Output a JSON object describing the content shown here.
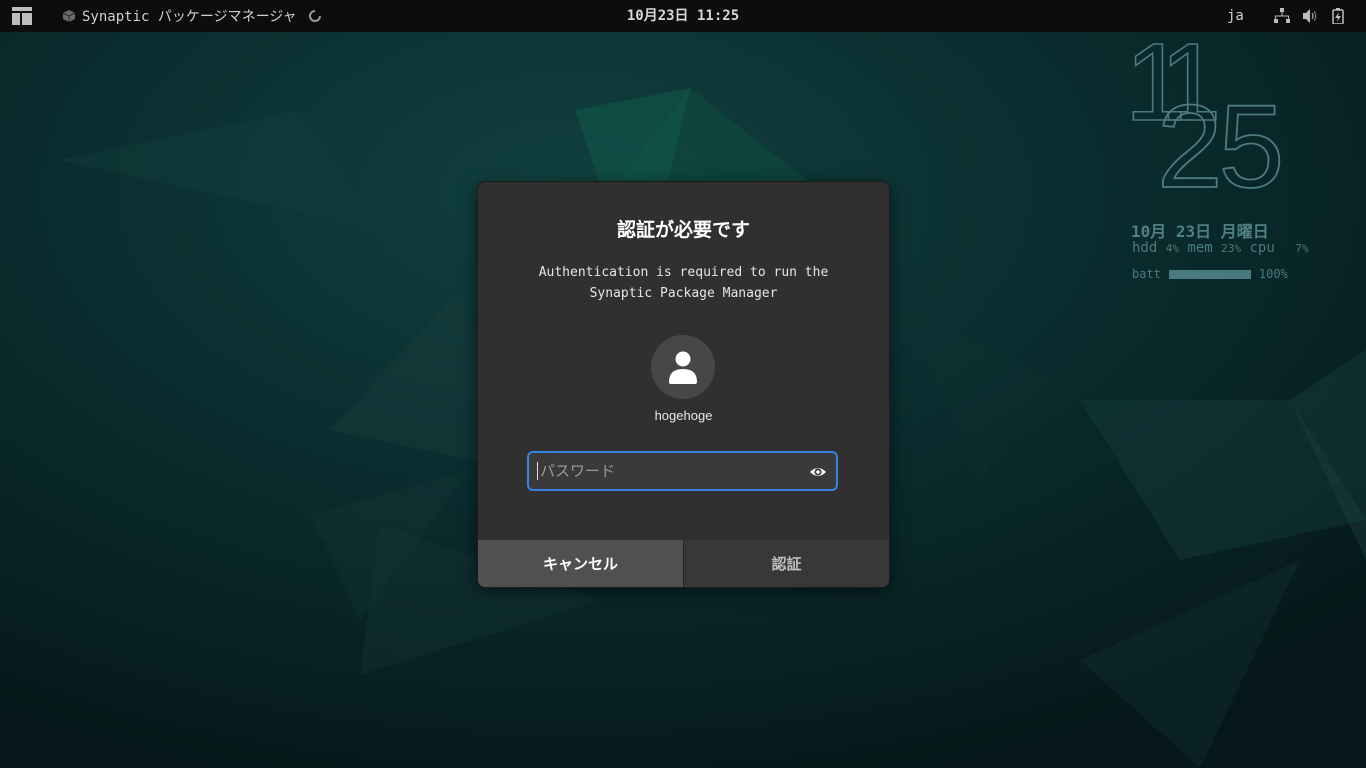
{
  "topbar": {
    "app_label": "Synaptic パッケージマネージャ",
    "clock": "10月23日  11:25",
    "language": "ja",
    "tray_icons": [
      "network-icon",
      "volume-icon",
      "battery-icon"
    ]
  },
  "conky": {
    "hours": "11",
    "minutes": "25",
    "date": "10月 23日 月曜日",
    "hdd_label": "hdd",
    "hdd_value": "4%",
    "mem_label": "mem",
    "mem_value": "23%",
    "cpu_label": "cpu",
    "cpu_value": "7%",
    "batt_label": "batt",
    "batt_value": "100%",
    "batt_level": 1.0
  },
  "dialog": {
    "title": "認証が必要です",
    "message": "Authentication is required to run the Synaptic Package Manager",
    "username": "hogehoge",
    "password_placeholder": "パスワード",
    "password_value": "",
    "cancel_label": "キャンセル",
    "authenticate_label": "認証"
  },
  "colors": {
    "accent": "#3584e4",
    "dialog_bg": "#303030",
    "conky_text": "#4d7c80"
  }
}
